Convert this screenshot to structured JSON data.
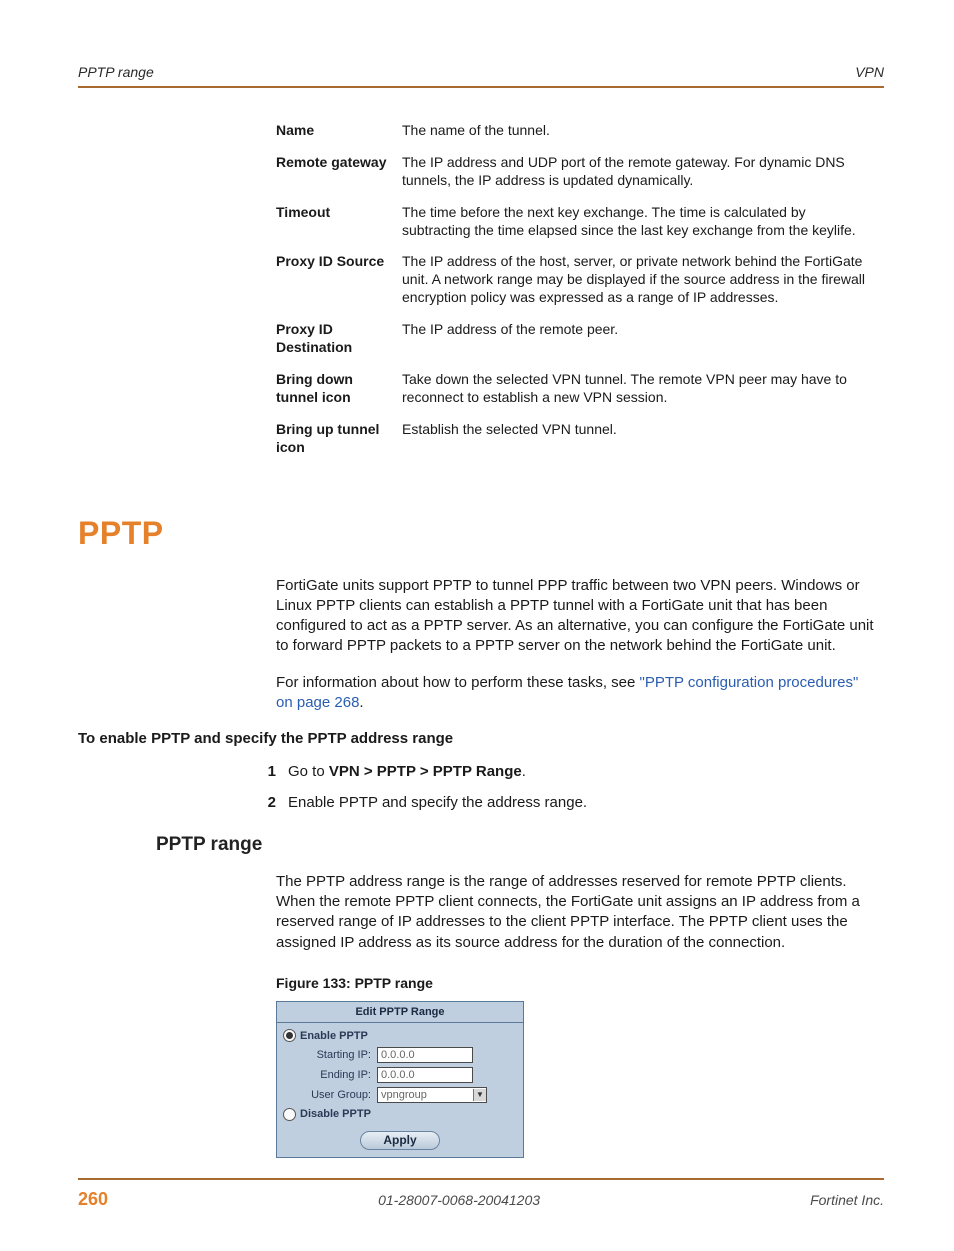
{
  "header": {
    "left": "PPTP range",
    "right": "VPN"
  },
  "defs": [
    {
      "term": "Name",
      "desc": "The name of the tunnel."
    },
    {
      "term": "Remote gateway",
      "desc": "The IP address and UDP port of the remote gateway. For dynamic DNS tunnels, the IP address is updated dynamically."
    },
    {
      "term": "Timeout",
      "desc": "The time before the next key exchange. The time is calculated by subtracting the time elapsed since the last key exchange from the keylife."
    },
    {
      "term": "Proxy ID Source",
      "desc": "The IP address of the host, server, or private network behind the FortiGate unit. A network range may be displayed if the source address in the firewall encryption policy was expressed as a range of IP addresses."
    },
    {
      "term": "Proxy ID Destination",
      "desc": "The IP address of the remote peer."
    },
    {
      "term": "Bring down tunnel icon",
      "desc": "Take down the selected VPN tunnel. The remote VPN peer may have to reconnect to establish a new VPN session."
    },
    {
      "term": "Bring up tunnel icon",
      "desc": "Establish the selected VPN tunnel."
    }
  ],
  "section_title": "PPTP",
  "intro_para": "FortiGate units support PPTP to tunnel PPP traffic between two VPN peers. Windows or Linux PPTP clients can establish a PPTP tunnel with a FortiGate unit that has been configured to act as a PPTP server. As an alternative, you can configure the FortiGate unit to forward PPTP packets to a PPTP server on the network behind the FortiGate unit.",
  "xref_lead": "For information about how to perform these tasks, see ",
  "xref_text": "\"PPTP configuration procedures\" on page 268",
  "xref_tail": ".",
  "task_heading": "To enable PPTP and specify the PPTP address range",
  "steps": [
    {
      "num": "1",
      "pre": "Go to ",
      "bold": "VPN > PPTP > PPTP Range",
      "post": "."
    },
    {
      "num": "2",
      "pre": "Enable PPTP and specify the address range.",
      "bold": "",
      "post": ""
    }
  ],
  "subsection_title": "PPTP range",
  "range_para": "The PPTP address range is the range of addresses reserved for remote PPTP clients. When the remote PPTP client connects, the FortiGate unit assigns an IP address from a reserved range of IP addresses to the client PPTP interface. The PPTP client uses the assigned IP address as its source address for the duration of the connection.",
  "figure_caption": "Figure 133: PPTP range",
  "panel": {
    "title": "Edit PPTP Range",
    "enable_label": "Enable PPTP",
    "disable_label": "Disable PPTP",
    "starting_label": "Starting IP:",
    "starting_val": "0.0.0.0",
    "ending_label": "Ending IP:",
    "ending_val": "0.0.0.0",
    "group_label": "User Group:",
    "group_val": "vpngroup",
    "apply": "Apply"
  },
  "footer": {
    "page": "260",
    "doc_id": "01-28007-0068-20041203",
    "company": "Fortinet Inc."
  }
}
